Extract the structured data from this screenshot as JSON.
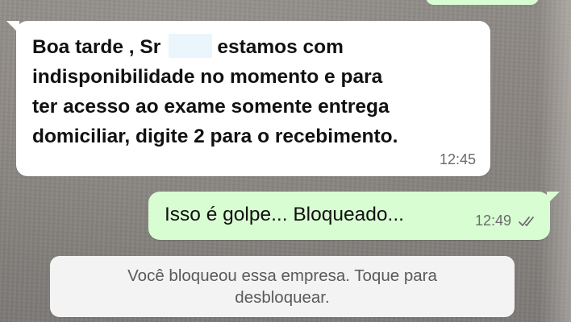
{
  "chat": {
    "incoming_message": {
      "line1_before_name": "Boa tarde , Sr",
      "line1_after_name": "estamos com",
      "line2": "indisponibilidade no momento e para",
      "line3": "ter acesso ao exame somente entrega",
      "line4": "domiciliar, digite 2 para o recebimento.",
      "time": "12:45"
    },
    "outgoing_message": {
      "text": "Isso é golpe... Bloqueado...",
      "time": "12:49",
      "status_icon": "double-check-icon"
    },
    "system_notice": {
      "line1": "Você bloqueou essa empresa. Toque para",
      "line2": "desbloquear."
    }
  },
  "colors": {
    "incoming_bubble": "#ffffff",
    "outgoing_bubble": "#d9fdd3",
    "system_bubble": "#f3f3f3",
    "time_text": "#6b6b6b",
    "read_ticks": "#6b6b6b"
  }
}
